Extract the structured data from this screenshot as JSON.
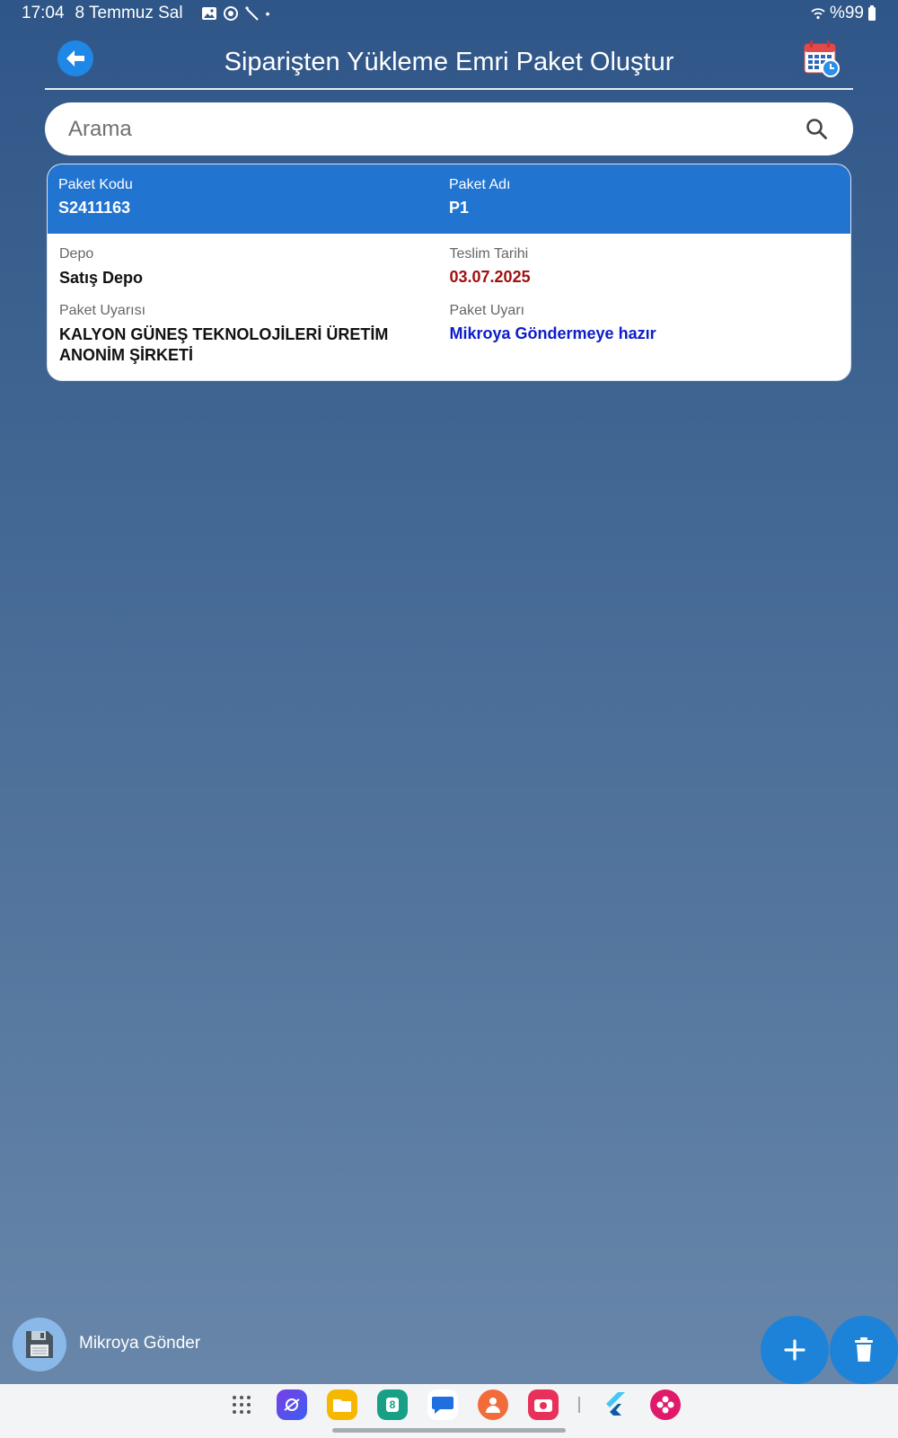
{
  "status_bar": {
    "time": "17:04",
    "date": "8 Temmuz Sal",
    "battery": "%99"
  },
  "app_bar": {
    "title": "Siparişten Yükleme Emri Paket Oluştur"
  },
  "search": {
    "placeholder": "Arama"
  },
  "card": {
    "paket_kodu_label": "Paket Kodu",
    "paket_kodu": "S2411163",
    "paket_adi_label": "Paket Adı",
    "paket_adi": "P1",
    "depo_label": "Depo",
    "depo": "Satış Depo",
    "teslim_label": "Teslim Tarihi",
    "teslim": "03.07.2025",
    "uyarisi_label": "Paket Uyarısı",
    "uyarisi": "KALYON GÜNEŞ TEKNOLOJİLERİ ÜRETİM ANONİM ŞİRKETİ",
    "uyari_label": "Paket Uyarı",
    "uyari": "Mikroya Göndermeye hazır"
  },
  "footer": {
    "send_label": "Mikroya Gönder"
  },
  "dock": {
    "calendar_day": "8"
  },
  "colors": {
    "header_blue": "#2274d1",
    "date_red": "#a01010",
    "status_blue": "#0c1ccc",
    "fab_blue": "#1d83d8"
  }
}
